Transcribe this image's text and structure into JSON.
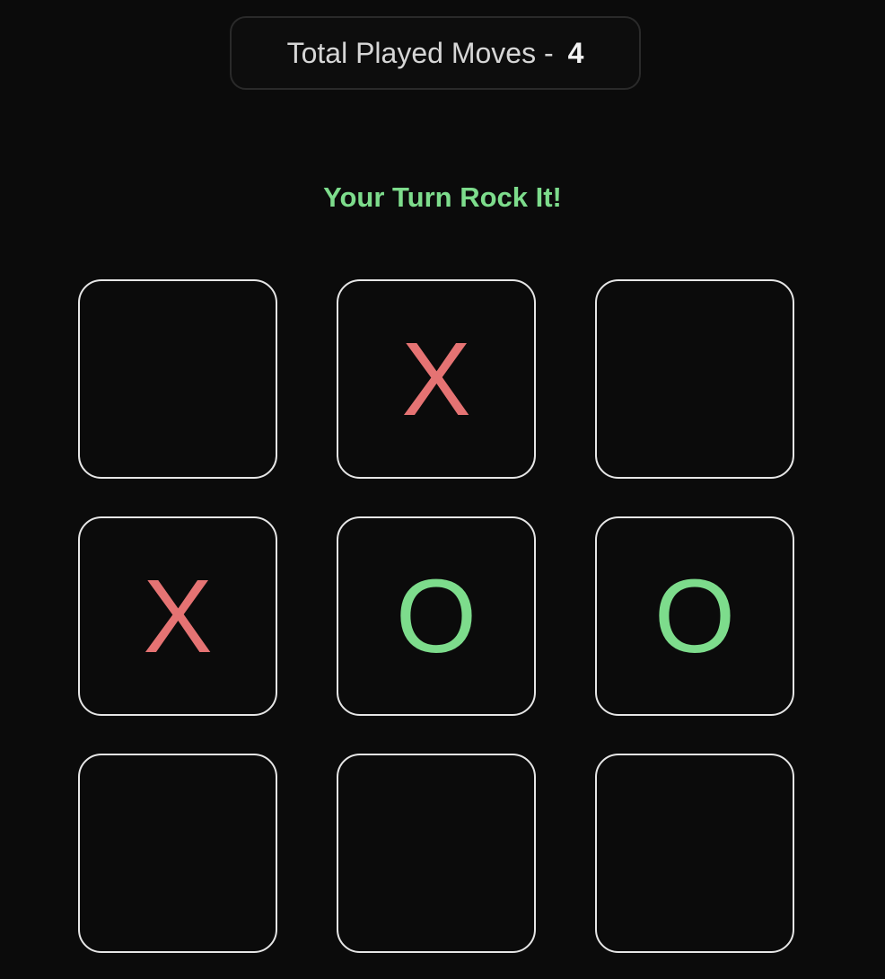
{
  "header": {
    "moves_label": "Total Played Moves -",
    "moves_count": "4"
  },
  "status": {
    "message": "Your Turn Rock It!",
    "color": "#7ddc8c"
  },
  "colors": {
    "X": "#e57373",
    "O": "#7ddc8c",
    "cell_border": "#e6e6e6",
    "background": "#0b0b0b"
  },
  "board": {
    "cells": [
      "",
      "X",
      "",
      "X",
      "O",
      "O",
      "",
      "",
      ""
    ]
  }
}
